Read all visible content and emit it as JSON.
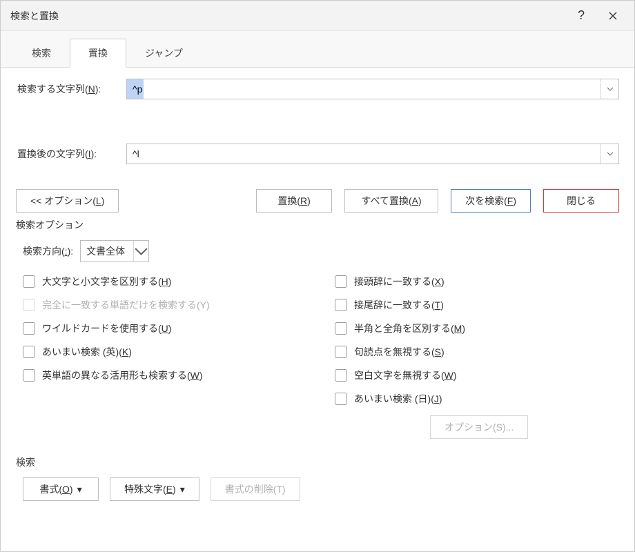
{
  "title": "検索と置換",
  "tabs": {
    "search": "検索",
    "replace": "置換",
    "jump": "ジャンプ",
    "active": "replace"
  },
  "fields": {
    "find_label_pre": "検索する文字列(",
    "find_label_key": "N",
    "find_label_post": "):",
    "find_value": "^p",
    "replace_label_pre": "置換後の文字列(",
    "replace_label_key": "I",
    "replace_label_post": "):",
    "replace_value": "^l"
  },
  "buttons": {
    "options_pre": "<< オプション(",
    "options_key": "L",
    "options_post": ")",
    "replace_pre": "置換(",
    "replace_key": "R",
    "replace_post": ")",
    "replace_all_pre": "すべて置換(",
    "replace_all_key": "A",
    "replace_all_post": ")",
    "find_next_pre": "次を検索(",
    "find_next_key": "F",
    "find_next_post": ")",
    "close": "閉じる"
  },
  "search_options_label": "検索オプション",
  "direction": {
    "label_pre": "検索方向(",
    "label_key": ":",
    "label_post": "):",
    "selected": "文書全体"
  },
  "checks": {
    "left": [
      {
        "pre": "大文字と小文字を区別する(",
        "key": "H",
        "post": ")",
        "disabled": false
      },
      {
        "pre": "完全に一致する単語だけを検索する(Y)",
        "key": "",
        "post": "",
        "disabled": true
      },
      {
        "pre": "ワイルドカードを使用する(",
        "key": "U",
        "post": ")",
        "disabled": false
      },
      {
        "pre": "あいまい検索 (英)(",
        "key": "K",
        "post": ")",
        "disabled": false
      },
      {
        "pre": "英単語の異なる活用形も検索する(",
        "key": "W",
        "post": ")",
        "disabled": false
      }
    ],
    "right": [
      {
        "pre": "接頭辞に一致する(",
        "key": "X",
        "post": ")",
        "disabled": false
      },
      {
        "pre": "接尾辞に一致する(",
        "key": "T",
        "post": ")",
        "disabled": false
      },
      {
        "pre": "半角と全角を区別する(",
        "key": "M",
        "post": ")",
        "disabled": false
      },
      {
        "pre": "句読点を無視する(",
        "key": "S",
        "post": ")",
        "disabled": false
      },
      {
        "pre": "空白文字を無視する(",
        "key": "W",
        "post": ")",
        "disabled": false
      },
      {
        "pre": "あいまい検索 (日)(",
        "key": "J",
        "post": ")",
        "disabled": false
      }
    ]
  },
  "fuzzy_options": {
    "pre": "オプション(S)",
    "post": "..."
  },
  "bottom_label": "検索",
  "bottom": {
    "format_pre": "書式(",
    "format_key": "O",
    "format_post": ")",
    "special_pre": "特殊文字(",
    "special_key": "E",
    "special_post": ")",
    "clear_pre": "書式の削除(T)",
    "clear_key": "",
    "clear_post": ""
  }
}
